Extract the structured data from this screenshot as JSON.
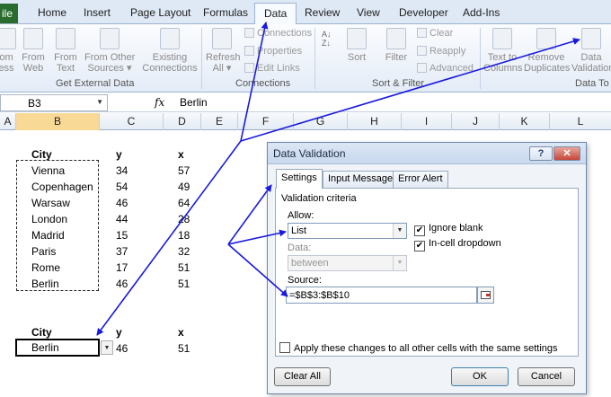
{
  "ribbon": {
    "file_tab": "ile",
    "tabs": [
      "Home",
      "Insert",
      "Page Layout",
      "Formulas",
      "Data",
      "Review",
      "View",
      "Developer",
      "Add-Ins"
    ],
    "active_tab": "Data",
    "get_external_data": {
      "buttons": [
        {
          "l1": "om",
          "l2": "ess"
        },
        {
          "l1": "From",
          "l2": "Web"
        },
        {
          "l1": "From",
          "l2": "Text"
        },
        {
          "l1": "From Other",
          "l2": "Sources ▾"
        },
        {
          "l1": "Existing",
          "l2": "Connections"
        }
      ],
      "label": "Get External Data"
    },
    "connections": {
      "refresh": {
        "l1": "Refresh",
        "l2": "All ▾"
      },
      "connections": "Connections",
      "properties": "Properties",
      "edit_links": "Edit Links",
      "label": "Connections"
    },
    "sort_filter": {
      "sort": "Sort",
      "filter": "Filter",
      "clear": "Clear",
      "reapply": "Reapply",
      "advanced": "Advanced",
      "label": "Sort & Filter"
    },
    "data_tools": {
      "text_to_columns": {
        "l1": "Text to",
        "l2": "Columns"
      },
      "remove_duplicates": {
        "l1": "Remove",
        "l2": "Duplicates"
      },
      "data_validation": {
        "l1": "Data",
        "l2": "Validation"
      },
      "label": "Data To"
    }
  },
  "formula_bar": {
    "name_box": "B3",
    "fx": "fx",
    "value": "Berlin"
  },
  "columns": [
    "A",
    "B",
    "C",
    "D",
    "E",
    "F",
    "G",
    "H",
    "I",
    "J",
    "K",
    "L"
  ],
  "selected_column": "B",
  "table": {
    "headers": [
      "City",
      "y",
      "x"
    ],
    "rows": [
      [
        "Vienna",
        "34",
        "57"
      ],
      [
        "Copenhagen",
        "54",
        "49"
      ],
      [
        "Warsaw",
        "46",
        "64"
      ],
      [
        "London",
        "44",
        "28"
      ],
      [
        "Madrid",
        "15",
        "18"
      ],
      [
        "Paris",
        "37",
        "32"
      ],
      [
        "Rome",
        "17",
        "51"
      ],
      [
        "Berlin",
        "46",
        "51"
      ]
    ]
  },
  "lookup": {
    "headers": [
      "City",
      "y",
      "x"
    ],
    "values": [
      "Berlin",
      "46",
      "51"
    ]
  },
  "dialog": {
    "title": "Data Validation",
    "help": "?",
    "close": "✕",
    "tabs": [
      "Settings",
      "Input Message",
      "Error Alert"
    ],
    "active_tab": "Settings",
    "validation_criteria": "Validation criteria",
    "allow_label": "Allow:",
    "allow_value": "List",
    "data_label": "Data:",
    "data_value": "between",
    "ignore_blank": "Ignore blank",
    "in_cell_dropdown": "In-cell dropdown",
    "source_label": "Source:",
    "source_value": "=$B$3:$B$10",
    "apply_all": "Apply these changes to all other cells with the same settings",
    "clear_all": "Clear All",
    "ok": "OK",
    "cancel": "Cancel"
  },
  "colors": {
    "arrow": "#1a1adf",
    "file_tab": "#2a6c2e",
    "selected_header": "#f9d996"
  }
}
